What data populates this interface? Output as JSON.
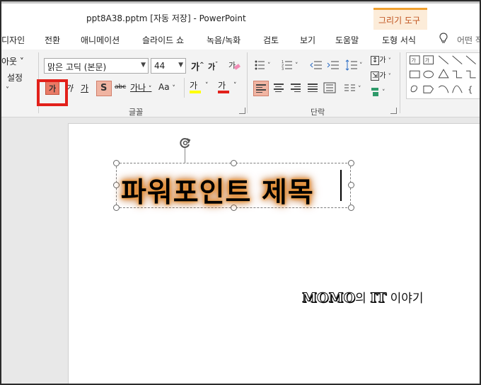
{
  "titlebar": {
    "title": "ppt8A38.pptm [자동 저장]  -  PowerPoint",
    "context_tab_group": "그리기 도구"
  },
  "tabs": [
    "디자인",
    "전환",
    "애니메이션",
    "슬라이드 쇼",
    "녹음/녹화",
    "검토",
    "보기",
    "도움말",
    "도형 서식"
  ],
  "search_hint": "어떤 작",
  "ribbon": {
    "left_items": [
      "아웃 ˅",
      "설정",
      "˅"
    ],
    "font": {
      "font_name": "맑은 고딕 (본문)",
      "font_size": "44",
      "grow_label": "가",
      "shrink_label": "가",
      "bold_label": "가",
      "italic_label": "가",
      "underline_label": "가",
      "shadow_label": "S",
      "strike_label": "abc",
      "spacing_label": "가나",
      "case_label": "Aa",
      "highlight_label": "가",
      "color_label": "가",
      "group_label": "글꼴"
    },
    "paragraph": {
      "group_label": "단락",
      "text_dir_label": "가",
      "align_text_label": "가"
    },
    "colors": {
      "bold_active": "#e97a66",
      "highlight_bar": "#ffff00",
      "font_color_bar": "#e2201a",
      "selection_box": "#e2201a",
      "context_accent": "#f0a030"
    }
  },
  "slide": {
    "title_text": "파워포인트 제목",
    "watermark": {
      "brand": "MOMO",
      "part1": "의",
      "it": "IT",
      "part2": "이야기"
    }
  },
  "icons": [
    "lightbulb-icon",
    "rotate-handle-icon",
    "bullets-icon",
    "numbering-icon",
    "decrease-indent-icon",
    "increase-indent-icon",
    "line-spacing-icon",
    "align-left-icon",
    "align-center-icon",
    "align-right-icon",
    "justify-icon",
    "columns-icon",
    "shapes-gallery-icon"
  ]
}
